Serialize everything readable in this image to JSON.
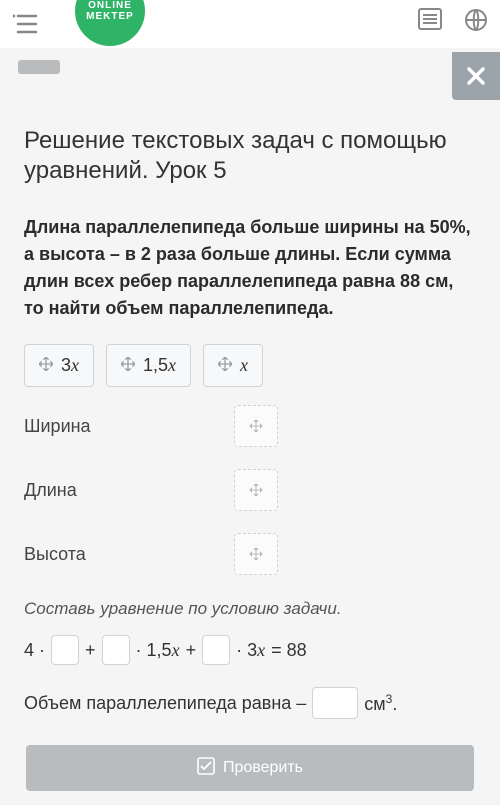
{
  "logo": {
    "line1": "ONLINE",
    "line2": "MEKTEP"
  },
  "title": "Решение текстовых задач с помощью уравнений. Урок 5",
  "problem": "Длина параллелепипеда больше ширины на 50%, а высота – в 2 раза больше длины. Если сумма длин всех ребер параллелепипеда равна 88 см, то найти объем параллелепипеда.",
  "tokens": [
    "3x",
    "1,5x",
    "x"
  ],
  "rows": {
    "width": "Ширина",
    "length": "Длина",
    "height": "Высота"
  },
  "instruction": "Составь уравнение по условию задачи.",
  "equation": {
    "p1": "4 ·",
    "p2": "+",
    "p3": "· 1,5",
    "p3v": "x",
    "p4": "+",
    "p5": "· 3",
    "p5v": "x",
    "p6": "= 88"
  },
  "answer": {
    "prefix": "Объем параллелепипеда равна –",
    "unit_base": "см",
    "unit_exp": "3",
    "dot": "."
  },
  "check": "Проверить"
}
